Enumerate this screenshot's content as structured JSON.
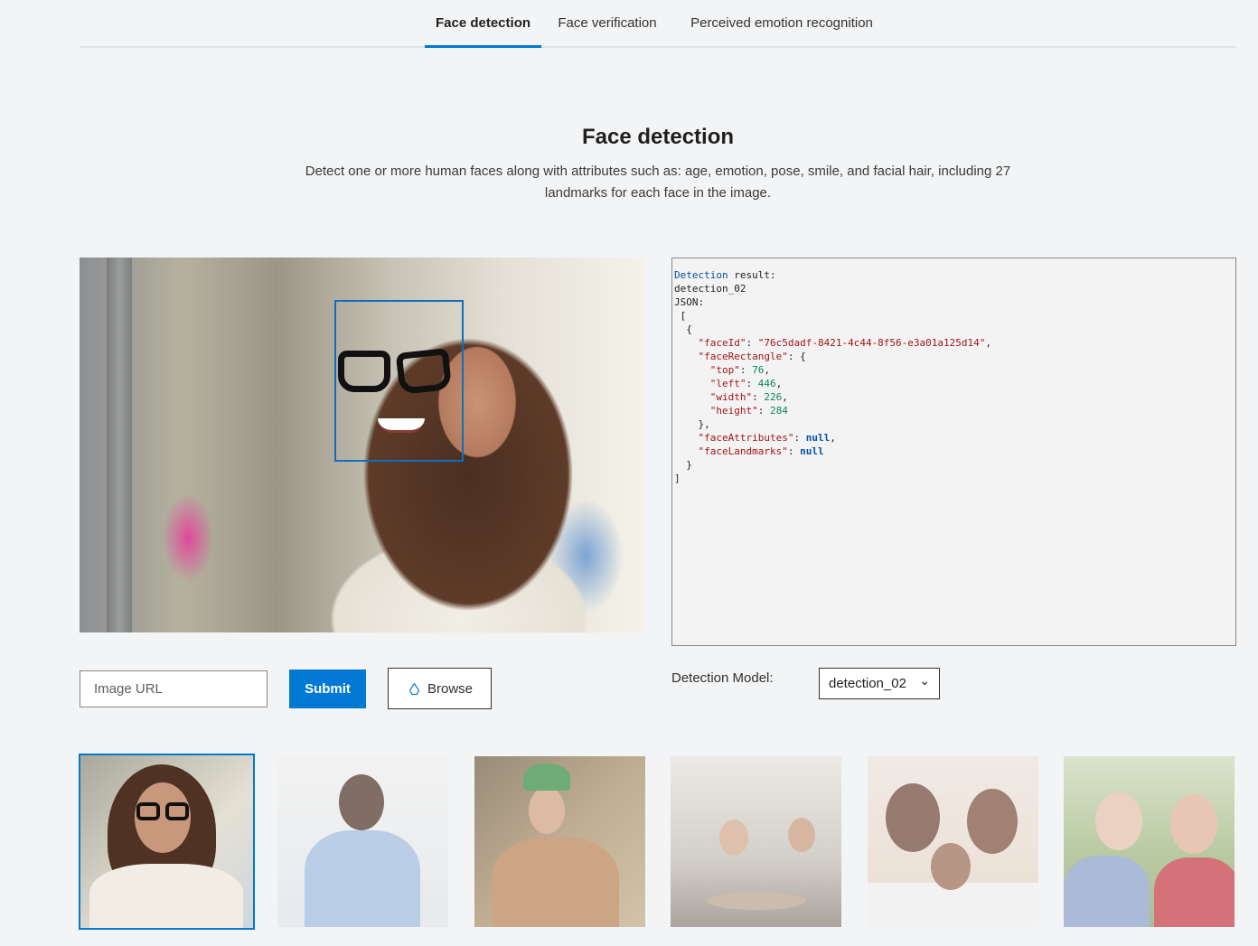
{
  "tabs": [
    {
      "label": "Face detection",
      "active": true
    },
    {
      "label": "Face verification",
      "active": false
    },
    {
      "label": "Perceived emotion recognition",
      "active": false
    }
  ],
  "hero": {
    "title": "Face detection",
    "description": "Detect one or more human faces along with attributes such as: age, emotion, pose, smile, and facial hair, including 27 landmarks for each face in the image."
  },
  "result": {
    "label_word": "Detection",
    "label_rest": " result:",
    "model_line": "detection_02",
    "json_label": "JSON:",
    "open_bracket": " [",
    "open_brace": "  {",
    "face_id_key": "\"faceId\"",
    "face_id_value": "\"76c5dadf-8421-4c44-8f56-e3a01a125d14\"",
    "face_rect_key": "\"faceRectangle\"",
    "top_key": "\"top\"",
    "top_value": "76",
    "left_key": "\"left\"",
    "left_value": "446",
    "width_key": "\"width\"",
    "width_value": "226",
    "height_key": "\"height\"",
    "height_value": "284",
    "face_attr_key": "\"faceAttributes\"",
    "face_attr_value": "null",
    "face_landmarks_key": "\"faceLandmarks\"",
    "face_landmarks_value": "null",
    "close_brace": "  }",
    "close_bracket": "]"
  },
  "controls": {
    "url_placeholder": "Image URL",
    "submit_label": "Submit",
    "browse_label": "Browse",
    "model_label": "Detection Model:",
    "model_value": "detection_02",
    "chevron": "⌄"
  },
  "thumbnails": [
    {
      "selected": true
    },
    {
      "selected": false
    },
    {
      "selected": false
    },
    {
      "selected": false
    },
    {
      "selected": false
    },
    {
      "selected": false
    }
  ],
  "colors": {
    "accent": "#0078d4",
    "background": "#f3f4f5",
    "json_key": "#a31515",
    "json_number": "#098658",
    "json_keyword": "#0451a5"
  }
}
